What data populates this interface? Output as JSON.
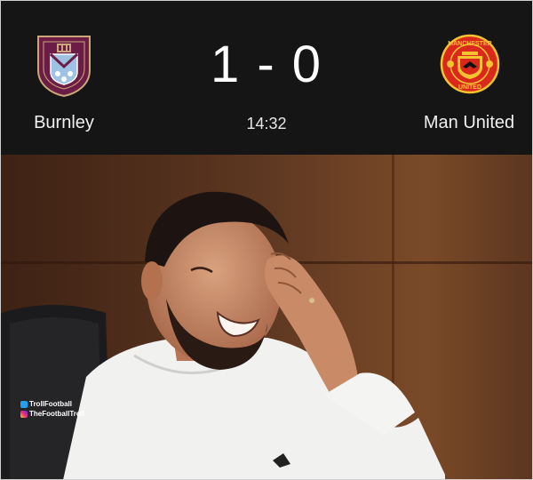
{
  "scoreboard": {
    "home_team": "Burnley",
    "away_team": "Man United",
    "score": "1 - 0",
    "match_clock": "14:32",
    "home_crest_icon": "burnley-crest-icon",
    "away_crest_icon": "manchester-united-crest-icon",
    "away_crest_text_top": "MANCHESTER",
    "away_crest_text_bottom": "UNITED",
    "home_color": "#6c1d45",
    "away_color": "#da291c"
  },
  "photo": {
    "subject": "man-laughing-hand-on-forehead",
    "watermark": {
      "twitter_handle": "TrollFootball",
      "instagram_handle": "TheFootballTroll"
    }
  }
}
